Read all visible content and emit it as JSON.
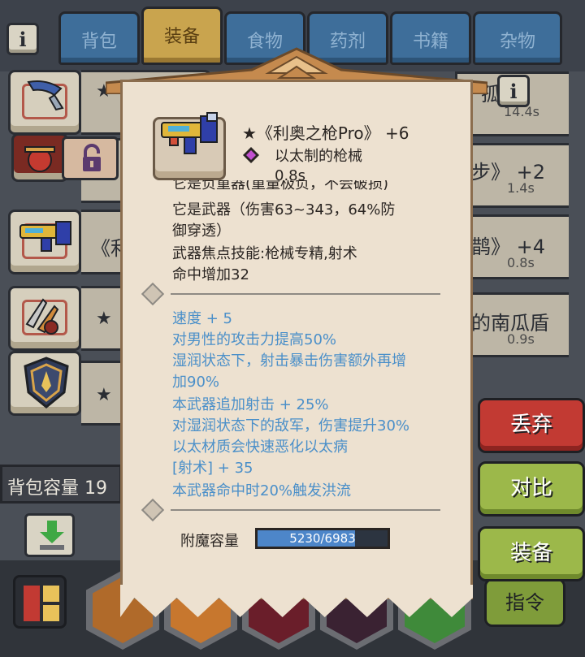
{
  "tabs": [
    {
      "label": "背包",
      "active": false
    },
    {
      "label": "装备",
      "active": true
    },
    {
      "label": "食物",
      "active": false
    },
    {
      "label": "药剂",
      "active": false
    },
    {
      "label": "书籍",
      "active": false
    },
    {
      "label": "杂物",
      "active": false
    }
  ],
  "info_icon": "i",
  "list": {
    "star": "★",
    "partial_prefix": "《利",
    "capacity": "背包容量 19"
  },
  "background_right": [
    {
      "text": "孤》",
      "sub": "14.4s"
    },
    {
      "text": "步》 +2",
      "sub": "1.4s"
    },
    {
      "text": "鹊》 +4",
      "sub": "0.8s"
    },
    {
      "text": "的南瓜盾",
      "sub": "0.9s"
    }
  ],
  "tooltip": {
    "title": "★《利奥之枪Pro》 +6",
    "subtitle": "以太制的枪械",
    "cooldown": "0.8s",
    "partial_line": "它是负重器(重量极负，不会破损)",
    "desc_lines": [
      "它是武器（伤害63~343，64%防",
      "御穿透）",
      "武器焦点技能:枪械专精,射术",
      "命中增加32"
    ],
    "bonus_lines": [
      "速度 + 5",
      "对男性的攻击力提高50%",
      "湿润状态下，射击暴击伤害额外再增",
      "加90%",
      "本武器追加射击 + 25%",
      "对湿润状态下的敌军，伤害提升30%",
      "以太材质会快速恶化以太病",
      "[射术] + 35",
      "本武器命中时20%触发洪流"
    ],
    "enchant_label": "附魔容量",
    "enchant_value": "5230/6983",
    "enchant_fraction": 0.749
  },
  "actions": {
    "discard": "丢弃",
    "compare": "对比",
    "equip": "装备",
    "command": "指令"
  },
  "colors": {
    "bonus_text": "#4a8fc9",
    "discard": "#c23a33",
    "green_button": "#9cb84a",
    "active_tab": "#c9a44e",
    "tab": "#3e6e9a"
  }
}
